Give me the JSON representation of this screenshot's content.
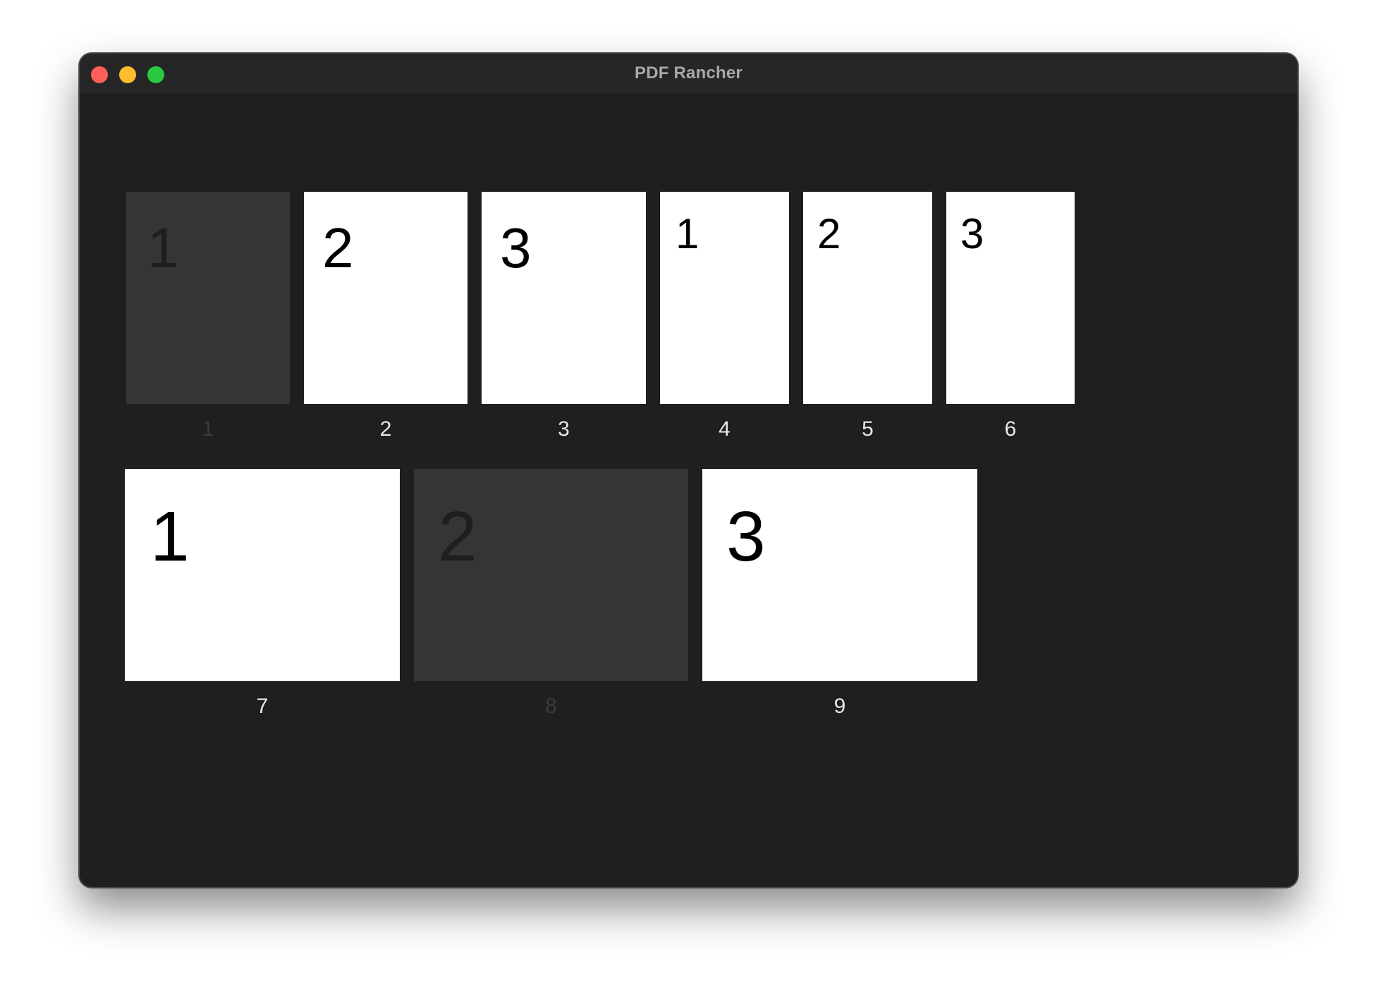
{
  "window": {
    "title": "PDF Rancher"
  },
  "pages": [
    {
      "label": "1",
      "content": "1",
      "state": "dimmed"
    },
    {
      "label": "2",
      "content": "2",
      "state": "normal"
    },
    {
      "label": "3",
      "content": "3",
      "state": "normal"
    },
    {
      "label": "4",
      "content": "1",
      "state": "normal"
    },
    {
      "label": "5",
      "content": "2",
      "state": "normal"
    },
    {
      "label": "6",
      "content": "3",
      "state": "normal"
    },
    {
      "label": "7",
      "content": "1",
      "state": "normal"
    },
    {
      "label": "8",
      "content": "2",
      "state": "dimmed"
    },
    {
      "label": "9",
      "content": "3",
      "state": "normal"
    }
  ]
}
